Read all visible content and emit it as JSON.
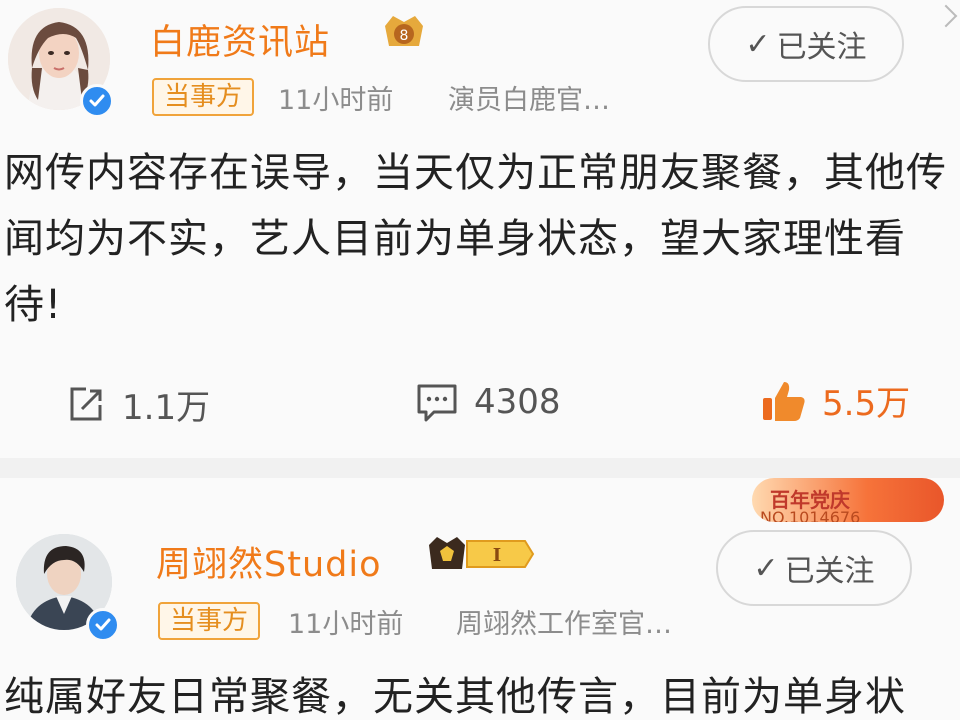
{
  "post1": {
    "author": "白鹿资讯站",
    "tag": "当事方",
    "time": "11小时前",
    "source": "演员白鹿官…",
    "follow_label": "已关注",
    "content": "网传内容存在误导，当天仅为正常朋友聚餐，其他传闻均为不实，艺人目前为单身状态，望大家理性看待!",
    "actions": {
      "repost": "1.1万",
      "comments": "4308",
      "likes": "5.5万"
    },
    "badge_icon": "gold-crown-badge"
  },
  "post2": {
    "author": "周翊然Studio",
    "tag": "当事方",
    "time": "11小时前",
    "source": "周翊然工作室官…",
    "follow_label": "已关注",
    "content": "纯属好友日常聚餐，无关其他传言，目前为单身状",
    "badge_icon": "crown-level-badge",
    "badge_level": "I",
    "banner_text": "百年党庆",
    "banner_sub": "NO.1014676"
  },
  "colors": {
    "name": "#f07a19",
    "tag_border": "#f0a33a",
    "verified": "#2f8cf0",
    "liked": "#ec6a1e"
  }
}
